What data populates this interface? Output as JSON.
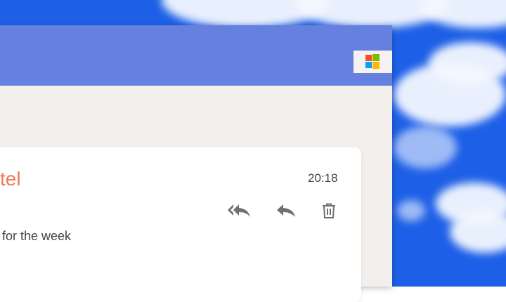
{
  "window": {
    "controls": {
      "minimize_icon": "minimize-icon",
      "maximize_icon": "maximize-icon",
      "close_icon": "close-icon"
    },
    "logo_icon": "windows-logo-icon",
    "titlebar_color": "#0f3ff0",
    "banner_color": "#6680e0",
    "close_color": "#ef6b4a"
  },
  "email": {
    "sender_fragment": "tel",
    "time": "20:18",
    "subject_fragment": "for the week",
    "actions": {
      "reply_all_icon": "reply-all-icon",
      "reply_icon": "reply-icon",
      "delete_icon": "trash-icon"
    },
    "accent_color": "#ef7a55"
  }
}
